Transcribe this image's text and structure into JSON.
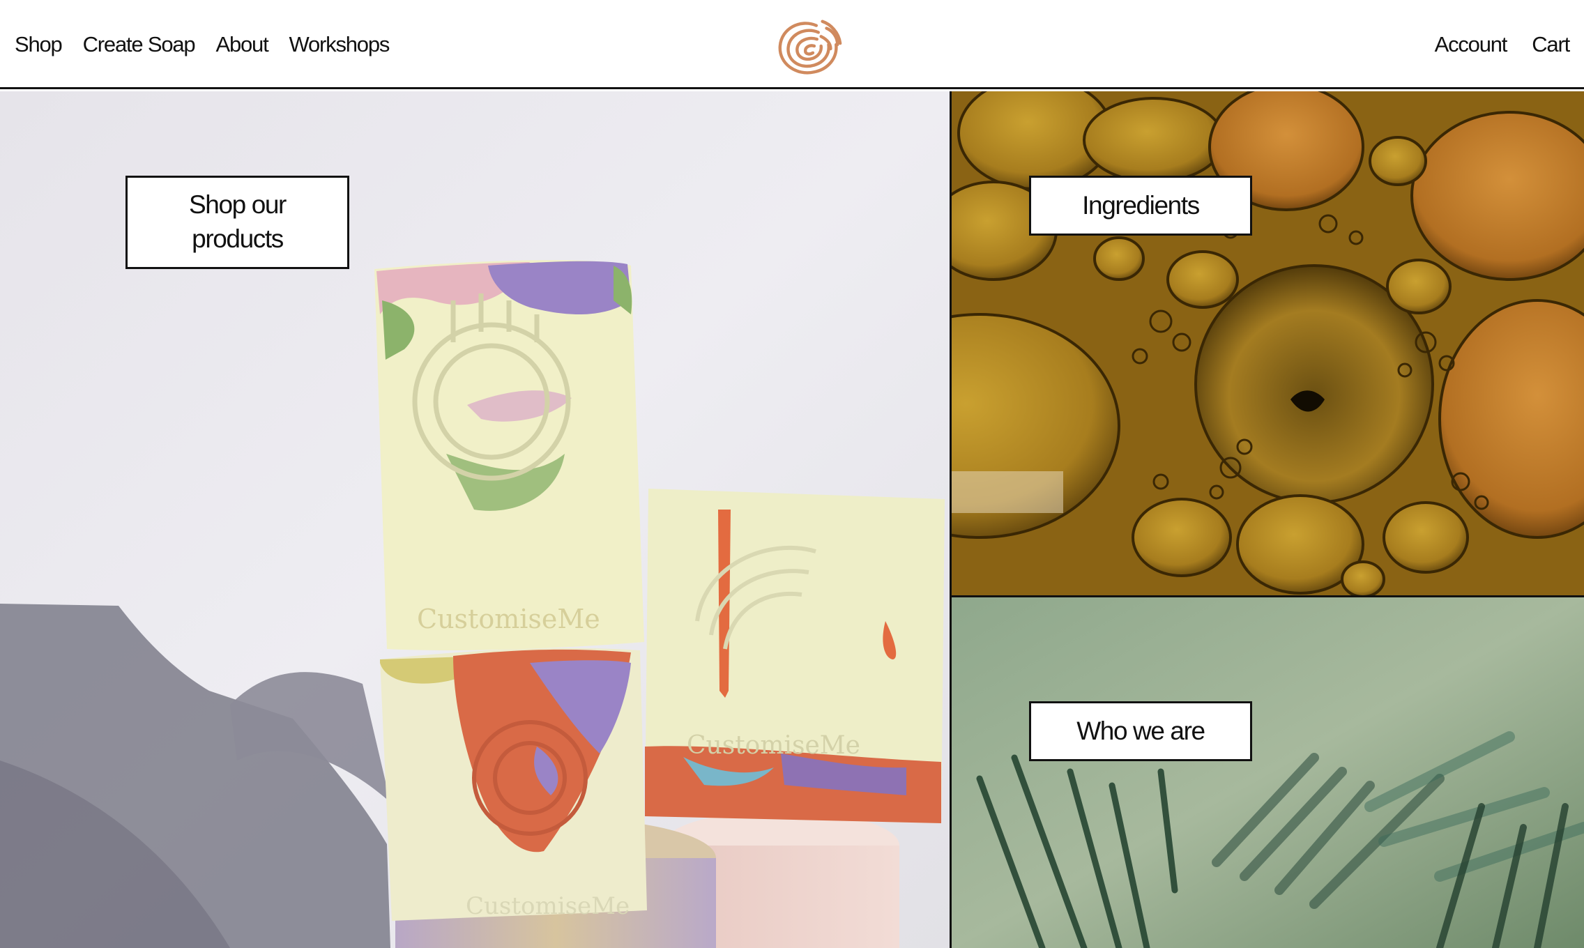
{
  "header": {
    "nav_left": [
      "Shop",
      "Create Soap",
      "About",
      "Workshops"
    ],
    "nav_right": [
      "Account",
      "Cart"
    ],
    "logo_icon": "swirl-logo-icon",
    "logo_color": "#d08a5e"
  },
  "tiles": {
    "shop": {
      "label": "Shop our products",
      "soap_imprint": "CustomiseMe"
    },
    "ingredients": {
      "label": "Ingredients"
    },
    "who": {
      "label": "Who we are"
    }
  },
  "colors": {
    "border": "#111111",
    "background": "#ffffff"
  }
}
